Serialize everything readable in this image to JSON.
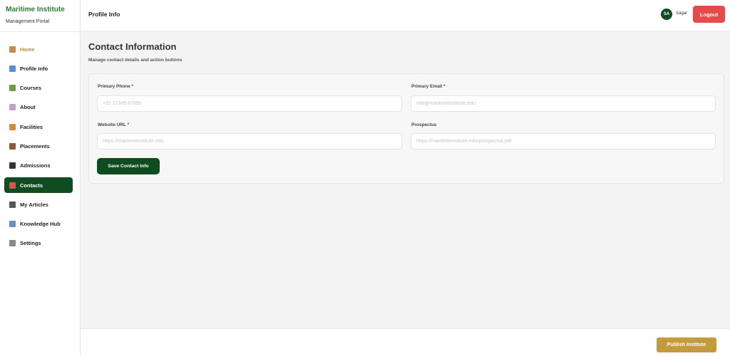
{
  "brand": {
    "title": "Maritime Institute",
    "subtitle": "Management Portal"
  },
  "sidebar": {
    "items": [
      {
        "label": "Home",
        "icon": "house-icon",
        "icon_color": "#c98a4b"
      },
      {
        "label": "Profile Info",
        "icon": "building-icon",
        "icon_color": "#5a8fd6"
      },
      {
        "label": "Courses",
        "icon": "books-icon",
        "icon_color": "#6f9a3d"
      },
      {
        "label": "About",
        "icon": "info-icon",
        "icon_color": "#c7a0c9"
      },
      {
        "label": "Facilities",
        "icon": "facility-icon",
        "icon_color": "#d9893a"
      },
      {
        "label": "Placements",
        "icon": "briefcase-icon",
        "icon_color": "#8a5a3a"
      },
      {
        "label": "Admissions",
        "icon": "graduation-cap-icon",
        "icon_color": "#333333"
      },
      {
        "label": "Contacts",
        "icon": "phone-icon",
        "icon_color": "#e05050"
      },
      {
        "label": "My Articles",
        "icon": "document-icon",
        "icon_color": "#555555"
      },
      {
        "label": "Knowledge Hub",
        "icon": "book-icon",
        "icon_color": "#6b8fc4"
      },
      {
        "label": "Settings",
        "icon": "gear-icon",
        "icon_color": "#888888"
      }
    ],
    "active_index": 7
  },
  "topbar": {
    "title": "Profile Info",
    "user_initials": "SA",
    "user_name": "Sagar",
    "logout_label": "Logout"
  },
  "main": {
    "title": "Contact Information",
    "subtitle": "Manage contact details and action buttons",
    "fields": {
      "primary_phone": {
        "label": "Primary Phone *",
        "placeholder": "+91 12345 67890",
        "value": ""
      },
      "primary_email": {
        "label": "Primary Email *",
        "placeholder": "info@maritimeinstitute.edu",
        "value": ""
      },
      "website_url": {
        "label": "Website URL *",
        "placeholder": "https://maritimeinstitute.edu",
        "value": ""
      },
      "prospectus": {
        "label": "Prospectus",
        "placeholder": "https://maritimeinstitute.edu/prospectus.pdf",
        "value": ""
      }
    },
    "save_label": "Save Contact Info"
  },
  "footer": {
    "publish_label": "Publish Institute"
  },
  "colors": {
    "brand_green": "#2e7d32",
    "primary_dark_green": "#0f4c20",
    "logout_red": "#e74a4a",
    "publish_gold": "#c49a3e",
    "home_gold": "#b8913f"
  }
}
